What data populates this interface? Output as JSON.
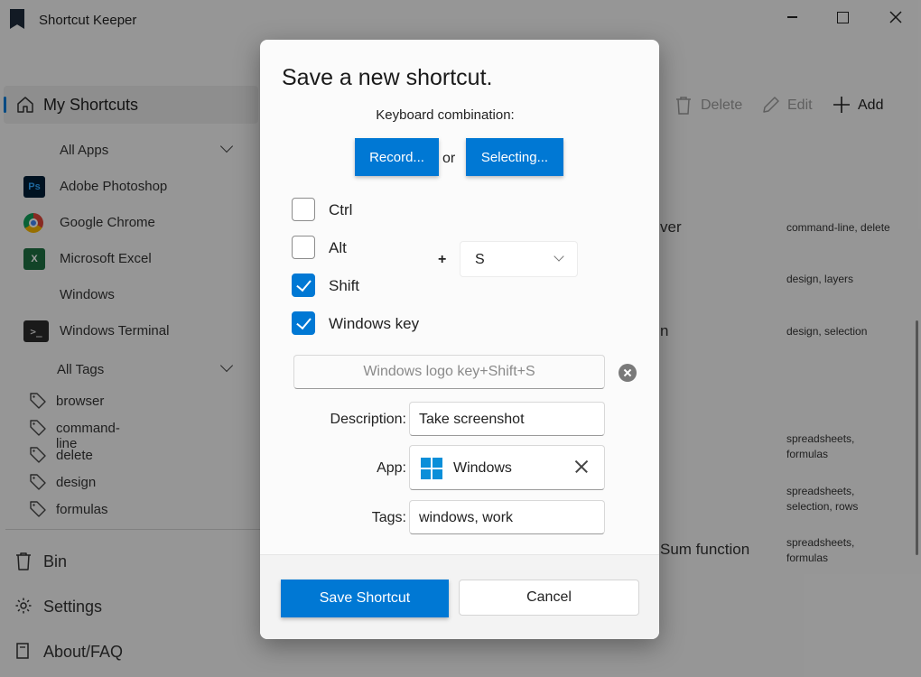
{
  "window": {
    "title": "Shortcut Keeper"
  },
  "sidebar": {
    "main_item": "My Shortcuts",
    "apps_header": "All Apps",
    "apps": [
      {
        "label": "Adobe Photoshop",
        "icon": "adobe-photoshop-icon",
        "abbr": "Ps"
      },
      {
        "label": "Google Chrome",
        "icon": "google-chrome-icon"
      },
      {
        "label": "Microsoft Excel",
        "icon": "microsoft-excel-icon",
        "abbr": "X"
      },
      {
        "label": "Windows",
        "icon": "windows-icon"
      },
      {
        "label": "Windows Terminal",
        "icon": "windows-terminal-icon",
        "abbr": ">_"
      }
    ],
    "tags_header": "All Tags",
    "tags": [
      "browser",
      "command-line",
      "delete",
      "design",
      "formulas"
    ],
    "footer": [
      {
        "label": "Bin",
        "icon": "bin-icon"
      },
      {
        "label": "Settings",
        "icon": "gear-icon"
      },
      {
        "label": "About/FAQ",
        "icon": "book-icon"
      }
    ]
  },
  "toolbar": {
    "delete_label": "Delete",
    "edit_label": "Edit",
    "add_label": "Add"
  },
  "background_rows": [
    {
      "name_fragment": "ver",
      "tags": "command-line, delete"
    },
    {
      "name_fragment": "",
      "tags": "design, layers"
    },
    {
      "name_fragment": "n",
      "tags": "design, selection"
    },
    {
      "name_fragment": "",
      "tags": "spreadsheets,\nformulas"
    },
    {
      "name_fragment": "",
      "tags": "spreadsheets,\nselection, rows"
    },
    {
      "name_fragment": "Sum function",
      "tags": "spreadsheets,\nformulas"
    }
  ],
  "dialog": {
    "title": "Save a new shortcut.",
    "keyboard_label": "Keyboard combination:",
    "record_label": "Record...",
    "or_label": "or",
    "selecting_label": "Selecting...",
    "modifiers": [
      {
        "label": "Ctrl",
        "checked": false
      },
      {
        "label": "Alt",
        "checked": false
      },
      {
        "label": "Shift",
        "checked": true
      },
      {
        "label": "Windows key",
        "checked": true
      }
    ],
    "plus": "+",
    "key_value": "S",
    "combination_text": "Windows logo key+Shift+S",
    "description_label": "Description:",
    "description_value": "Take screenshot",
    "app_label": "App:",
    "app_value": "Windows",
    "tags_label": "Tags:",
    "tags_value": "windows, work",
    "save_label": "Save Shortcut",
    "cancel_label": "Cancel"
  },
  "colors": {
    "accent": "#0078d4",
    "dialog_bg": "#fbfbfb",
    "overlay": "rgba(0,0,0,0.38)"
  }
}
